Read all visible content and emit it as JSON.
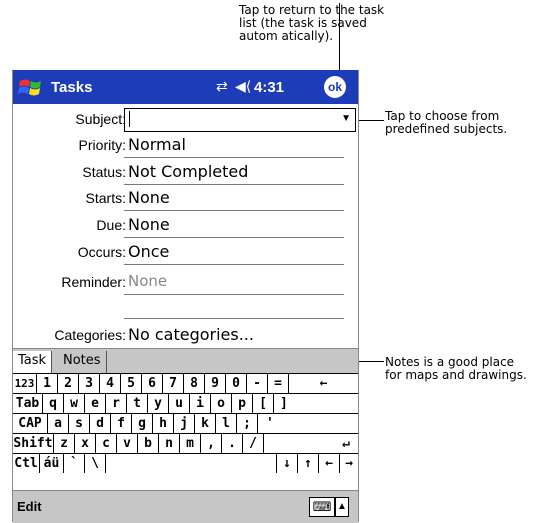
{
  "callouts": {
    "top": [
      "Tap to return to the task",
      "list (the task is saved",
      "autom atically)."
    ],
    "subject": [
      "Tap to choose from",
      "predefined subjects."
    ],
    "notes": [
      "Notes is a good place",
      "for maps and drawings."
    ]
  },
  "titlebar": {
    "app_name": "Tasks",
    "time": "4:31",
    "ok_label": "ok",
    "icons": [
      "windows-start-icon",
      "connectivity-icon",
      "volume-icon"
    ]
  },
  "form": {
    "subject": {
      "label": "Subject:",
      "value": ""
    },
    "priority": {
      "label": "Priority:",
      "value": "Normal"
    },
    "status": {
      "label": "Status:",
      "value": "Not Completed"
    },
    "starts": {
      "label": "Starts:",
      "value": "None"
    },
    "due": {
      "label": "Due:",
      "value": "None"
    },
    "occurs": {
      "label": "Occurs:",
      "value": "Once"
    },
    "reminder": {
      "label": "Reminder:",
      "value": "None"
    },
    "categories": {
      "label": "Categories:",
      "value": "No categories..."
    }
  },
  "tabs": {
    "task": "Task",
    "notes": "Notes"
  },
  "keyboard": {
    "row1": [
      "123",
      "1",
      "2",
      "3",
      "4",
      "5",
      "6",
      "7",
      "8",
      "9",
      "0",
      "-",
      "=",
      "←"
    ],
    "row2": [
      "Tab",
      "q",
      "w",
      "e",
      "r",
      "t",
      "y",
      "u",
      "i",
      "o",
      "p",
      "[",
      "]"
    ],
    "row3": [
      "CAP",
      "a",
      "s",
      "d",
      "f",
      "g",
      "h",
      "j",
      "k",
      "l",
      ";",
      "'"
    ],
    "row4": [
      "Shift",
      "z",
      "x",
      "c",
      "v",
      "b",
      "n",
      "m",
      ",",
      ".",
      "/",
      "↵"
    ],
    "row5": [
      "Ctl",
      "áü",
      "`",
      "\\",
      "",
      "↓",
      "↑",
      "←",
      "→"
    ]
  },
  "menubar": {
    "edit": "Edit"
  },
  "colors": {
    "titlebar": "#1d3cb8",
    "chrome_gray": "#c6c6c6"
  }
}
